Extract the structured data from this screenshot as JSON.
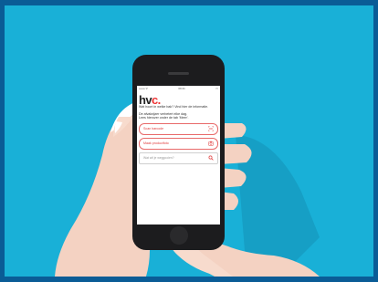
{
  "app": {
    "logo_text": "hv",
    "logo_accent": "c.",
    "logo_accent_color": "#e33"
  },
  "status_bar": {
    "carrier": "•••oo ᯤ",
    "time": "09:41",
    "battery": "▭"
  },
  "intro": {
    "line1": "Wat hoort in welke bak? Vind hier de informatie.",
    "line2": "De afvalwijzer verbetert elke dag.",
    "line3": "Lees hierover onder de tab 'Meer'."
  },
  "actions": {
    "scan_label": "Scan barcode",
    "scan_icon": "barcode-icon",
    "photo_label": "Maak productfoto",
    "photo_icon": "camera-icon"
  },
  "search": {
    "placeholder": "Wat wil je weggooien?",
    "icon": "search-icon"
  },
  "colors": {
    "frame": "#0a5c96",
    "background": "#19b0d7",
    "accent": "#e03a3a"
  }
}
